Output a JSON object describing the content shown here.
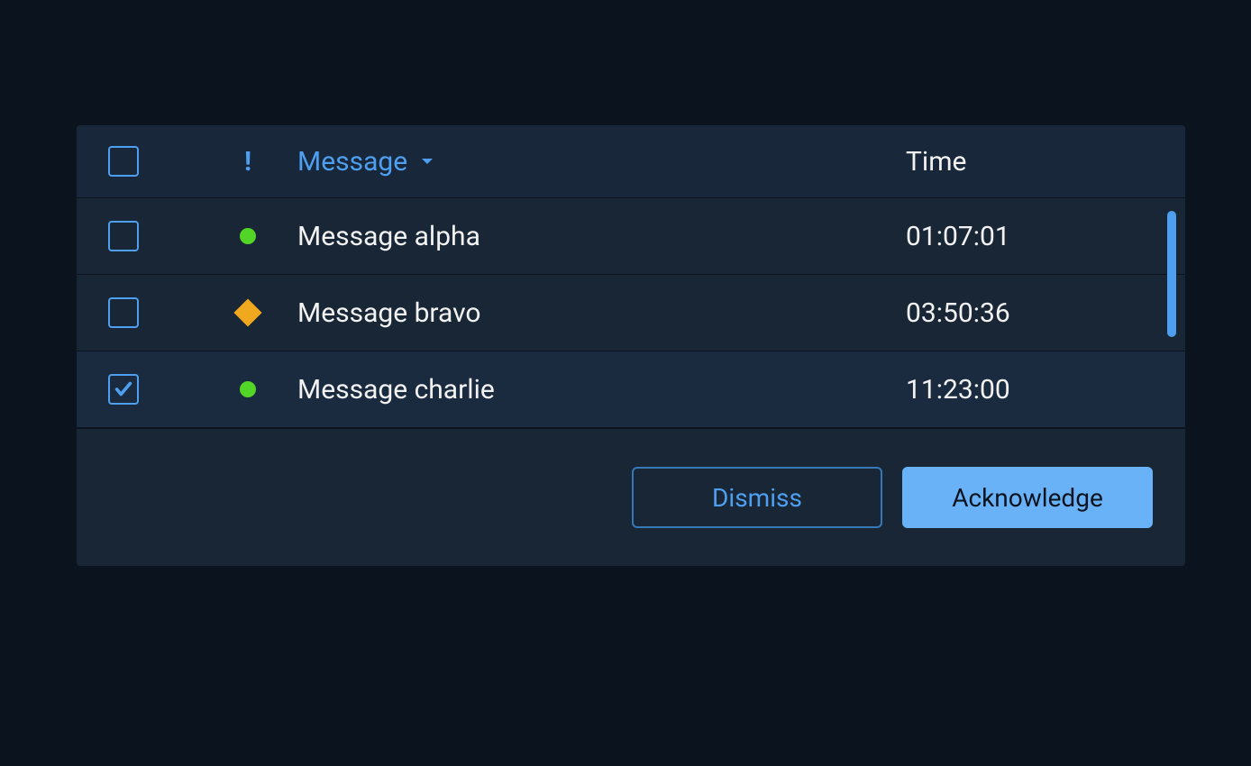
{
  "table": {
    "header": {
      "severity_label": "!",
      "message_label": "Message",
      "time_label": "Time"
    },
    "rows": [
      {
        "checked": false,
        "severity": "ok",
        "message": "Message alpha",
        "time": "01:07:01"
      },
      {
        "checked": false,
        "severity": "caution",
        "message": "Message bravo",
        "time": "03:50:36"
      },
      {
        "checked": true,
        "severity": "ok",
        "message": "Message charlie",
        "time": "11:23:00"
      }
    ]
  },
  "footer": {
    "dismiss_label": "Dismiss",
    "acknowledge_label": "Acknowledge"
  },
  "colors": {
    "accent": "#4e9fef",
    "ok": "#53d528",
    "caution": "#f0a91e"
  }
}
